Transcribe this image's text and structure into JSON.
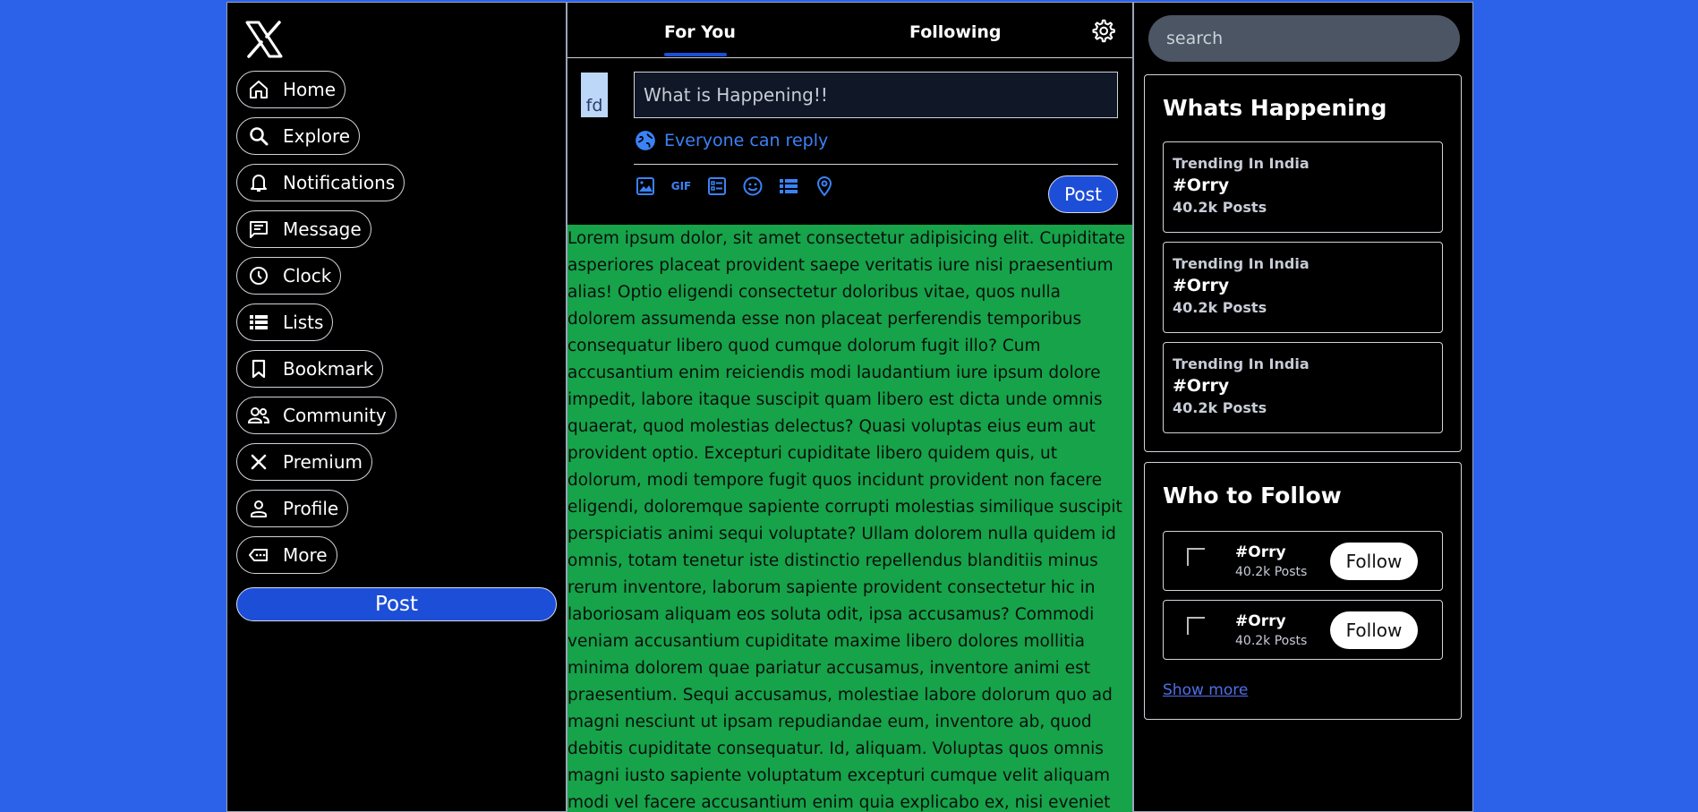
{
  "sidebar": {
    "logo_icon": "x-logo-icon",
    "items": [
      {
        "label": "Home",
        "icon": "home-icon"
      },
      {
        "label": "Explore",
        "icon": "search-icon"
      },
      {
        "label": "Notifications",
        "icon": "bell-icon"
      },
      {
        "label": "Message",
        "icon": "message-icon"
      },
      {
        "label": "Clock",
        "icon": "clock-icon"
      },
      {
        "label": "Lists",
        "icon": "list-icon"
      },
      {
        "label": "Bookmark",
        "icon": "bookmark-icon"
      },
      {
        "label": "Community",
        "icon": "community-icon"
      },
      {
        "label": "Premium",
        "icon": "x-icon"
      },
      {
        "label": "Profile",
        "icon": "profile-icon"
      },
      {
        "label": "More",
        "icon": "more-icon"
      }
    ],
    "post_label": "Post"
  },
  "feed": {
    "tabs": [
      {
        "label": "For You",
        "active": true
      },
      {
        "label": "Following",
        "active": false
      }
    ],
    "composer": {
      "avatar_alt": "fd",
      "placeholder": "What is Happening!!",
      "reply_label": "Everyone can reply",
      "tools": [
        "image-icon",
        "gif-icon",
        "poll-icon",
        "emoji-icon",
        "schedule-list-icon",
        "location-icon"
      ],
      "gif_label": "GIF",
      "post_label": "Post"
    },
    "post_text": "Lorem ipsum dolor, sit amet consectetur adipisicing elit. Cupiditate asperiores placeat provident saepe veritatis iure nisi praesentium alias! Optio eligendi consectetur doloribus vitae, quos nulla dolorem assumenda esse non placeat perferendis temporibus consequatur libero quod cumque dolorum fugit illo? Cum accusantium enim reiciendis modi laudantium iure ipsum dolore impedit, labore itaque suscipit quam libero est dicta unde omnis quaerat, quod molestias delectus? Quasi voluptas eius eum aut provident optio. Excepturi cupiditate libero quidem quis, ut dolorum, modi tempore fugit quos incidunt provident non facere eligendi, doloremque sapiente corrupti molestias similique suscipit perspiciatis animi sequi voluptate? Ullam dolorem nulla quidem id omnis, totam tenetur iste distinctio repellendus blanditiis minus rerum inventore, laborum sapiente provident consectetur hic in laboriosam aliquam eos soluta odit, ipsa accusamus? Commodi veniam accusantium cupiditate maxime libero dolores mollitia minima dolorem quae pariatur accusamus, inventore animi est praesentium. Sequi accusamus, molestiae labore dolorum quo ad magni nesciunt ut ipsam repudiandae eum, inventore ab, quod debitis cupiditate consequatur. Id, aliquam. Voluptas quos omnis magni iusto sapiente voluptatum excepturi cumque velit aliquam modi vel facere accusantium enim quia explicabo ex, nisi eveniet autem sequi dolorum. Dolorum, magni, ratione reprehenderit error placeat"
  },
  "right": {
    "search_placeholder": "search",
    "whats_happening": {
      "title": "Whats Happening",
      "trends": [
        {
          "category": "Trending In India",
          "tag": "#Orry",
          "count": "40.2k Posts"
        },
        {
          "category": "Trending In India",
          "tag": "#Orry",
          "count": "40.2k Posts"
        },
        {
          "category": "Trending In India",
          "tag": "#Orry",
          "count": "40.2k Posts"
        }
      ]
    },
    "who_to_follow": {
      "title": "Who to Follow",
      "accounts": [
        {
          "name": "#Orry",
          "sub": "40.2k Posts",
          "button": "Follow"
        },
        {
          "name": "#Orry",
          "sub": "40.2k Posts",
          "button": "Follow"
        }
      ],
      "show_more": "Show more"
    }
  },
  "colors": {
    "background": "#2c61ea",
    "accent": "#1d4ed8",
    "post_bg": "#16a34a",
    "link": "#3b82f6"
  }
}
